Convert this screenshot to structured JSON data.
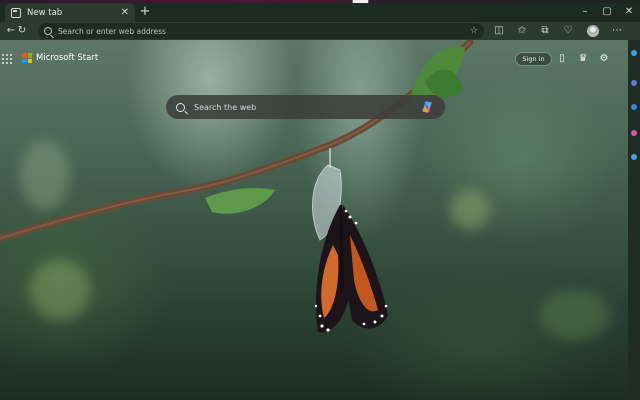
{
  "tab": {
    "title": "New tab",
    "close_glyph": "✕"
  },
  "new_tab_glyph": "+",
  "window_controls": {
    "minimize": "–",
    "maximize": "▢",
    "close": "✕"
  },
  "address_bar": {
    "placeholder": "Search or enter web address"
  },
  "page": {
    "brand": "Microsoft Start",
    "sign_in": "Sign in",
    "search": {
      "placeholder": "Search the web"
    }
  },
  "colors": {
    "ms_red": "#f25022",
    "ms_green": "#7fba00",
    "ms_blue": "#00a4ef",
    "ms_yellow": "#ffb900"
  },
  "icons": [
    "back-icon",
    "refresh-icon",
    "search-icon",
    "star-icon",
    "split-screen-icon",
    "favorites-icon",
    "collections-icon",
    "browser-essentials-icon",
    "profile-avatar",
    "more-icon",
    "apps-grid-icon",
    "mobile-icon",
    "rewards-icon",
    "settings-icon",
    "copilot-icon"
  ]
}
